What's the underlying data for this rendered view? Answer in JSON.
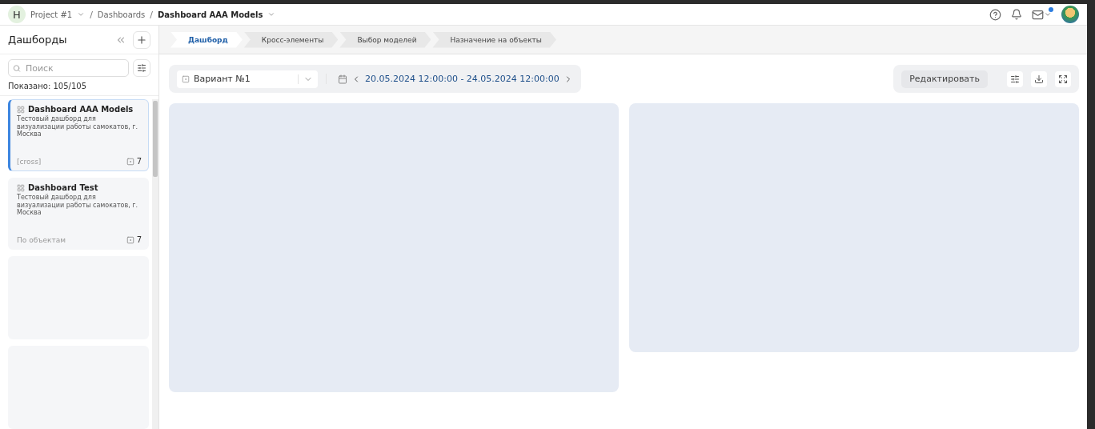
{
  "header": {
    "avatar_letter": "H",
    "breadcrumbs": [
      {
        "label": "Project #1",
        "dropdown": true,
        "current": false
      },
      {
        "separator": "/",
        "label": "Dashboards",
        "dropdown": false,
        "current": false
      },
      {
        "separator": "/",
        "label": "Dashboard AAA Models",
        "dropdown": true,
        "current": true
      }
    ],
    "mail_unread": true
  },
  "sidebar": {
    "title": "Дашборды",
    "search": {
      "placeholder": "Поиск"
    },
    "shown": "Показано: 105/105",
    "items": [
      {
        "title": "Dashboard AAA Models",
        "description": "Тестовый дашборд для визуализации работы самокатов, г. Москва",
        "tag": "[cross]",
        "count": "7",
        "selected": true
      },
      {
        "title": "Dashboard Test",
        "description": "Тестовый дашборд для визуализации работы самокатов, г. Москва",
        "tag": "По объектам",
        "count": "7",
        "selected": false
      }
    ]
  },
  "steps": [
    {
      "label": "Дашборд",
      "selected": true
    },
    {
      "label": "Кросс-элементы",
      "selected": false
    },
    {
      "label": "Выбор моделей",
      "selected": false
    },
    {
      "label": "Назначение на объекты",
      "selected": false
    }
  ],
  "toolbar": {
    "variant": "Вариант №1",
    "date_range": "20.05.2024 12:00:00 - 24.05.2024 12:00:00",
    "edit_button": "Редактировать"
  }
}
